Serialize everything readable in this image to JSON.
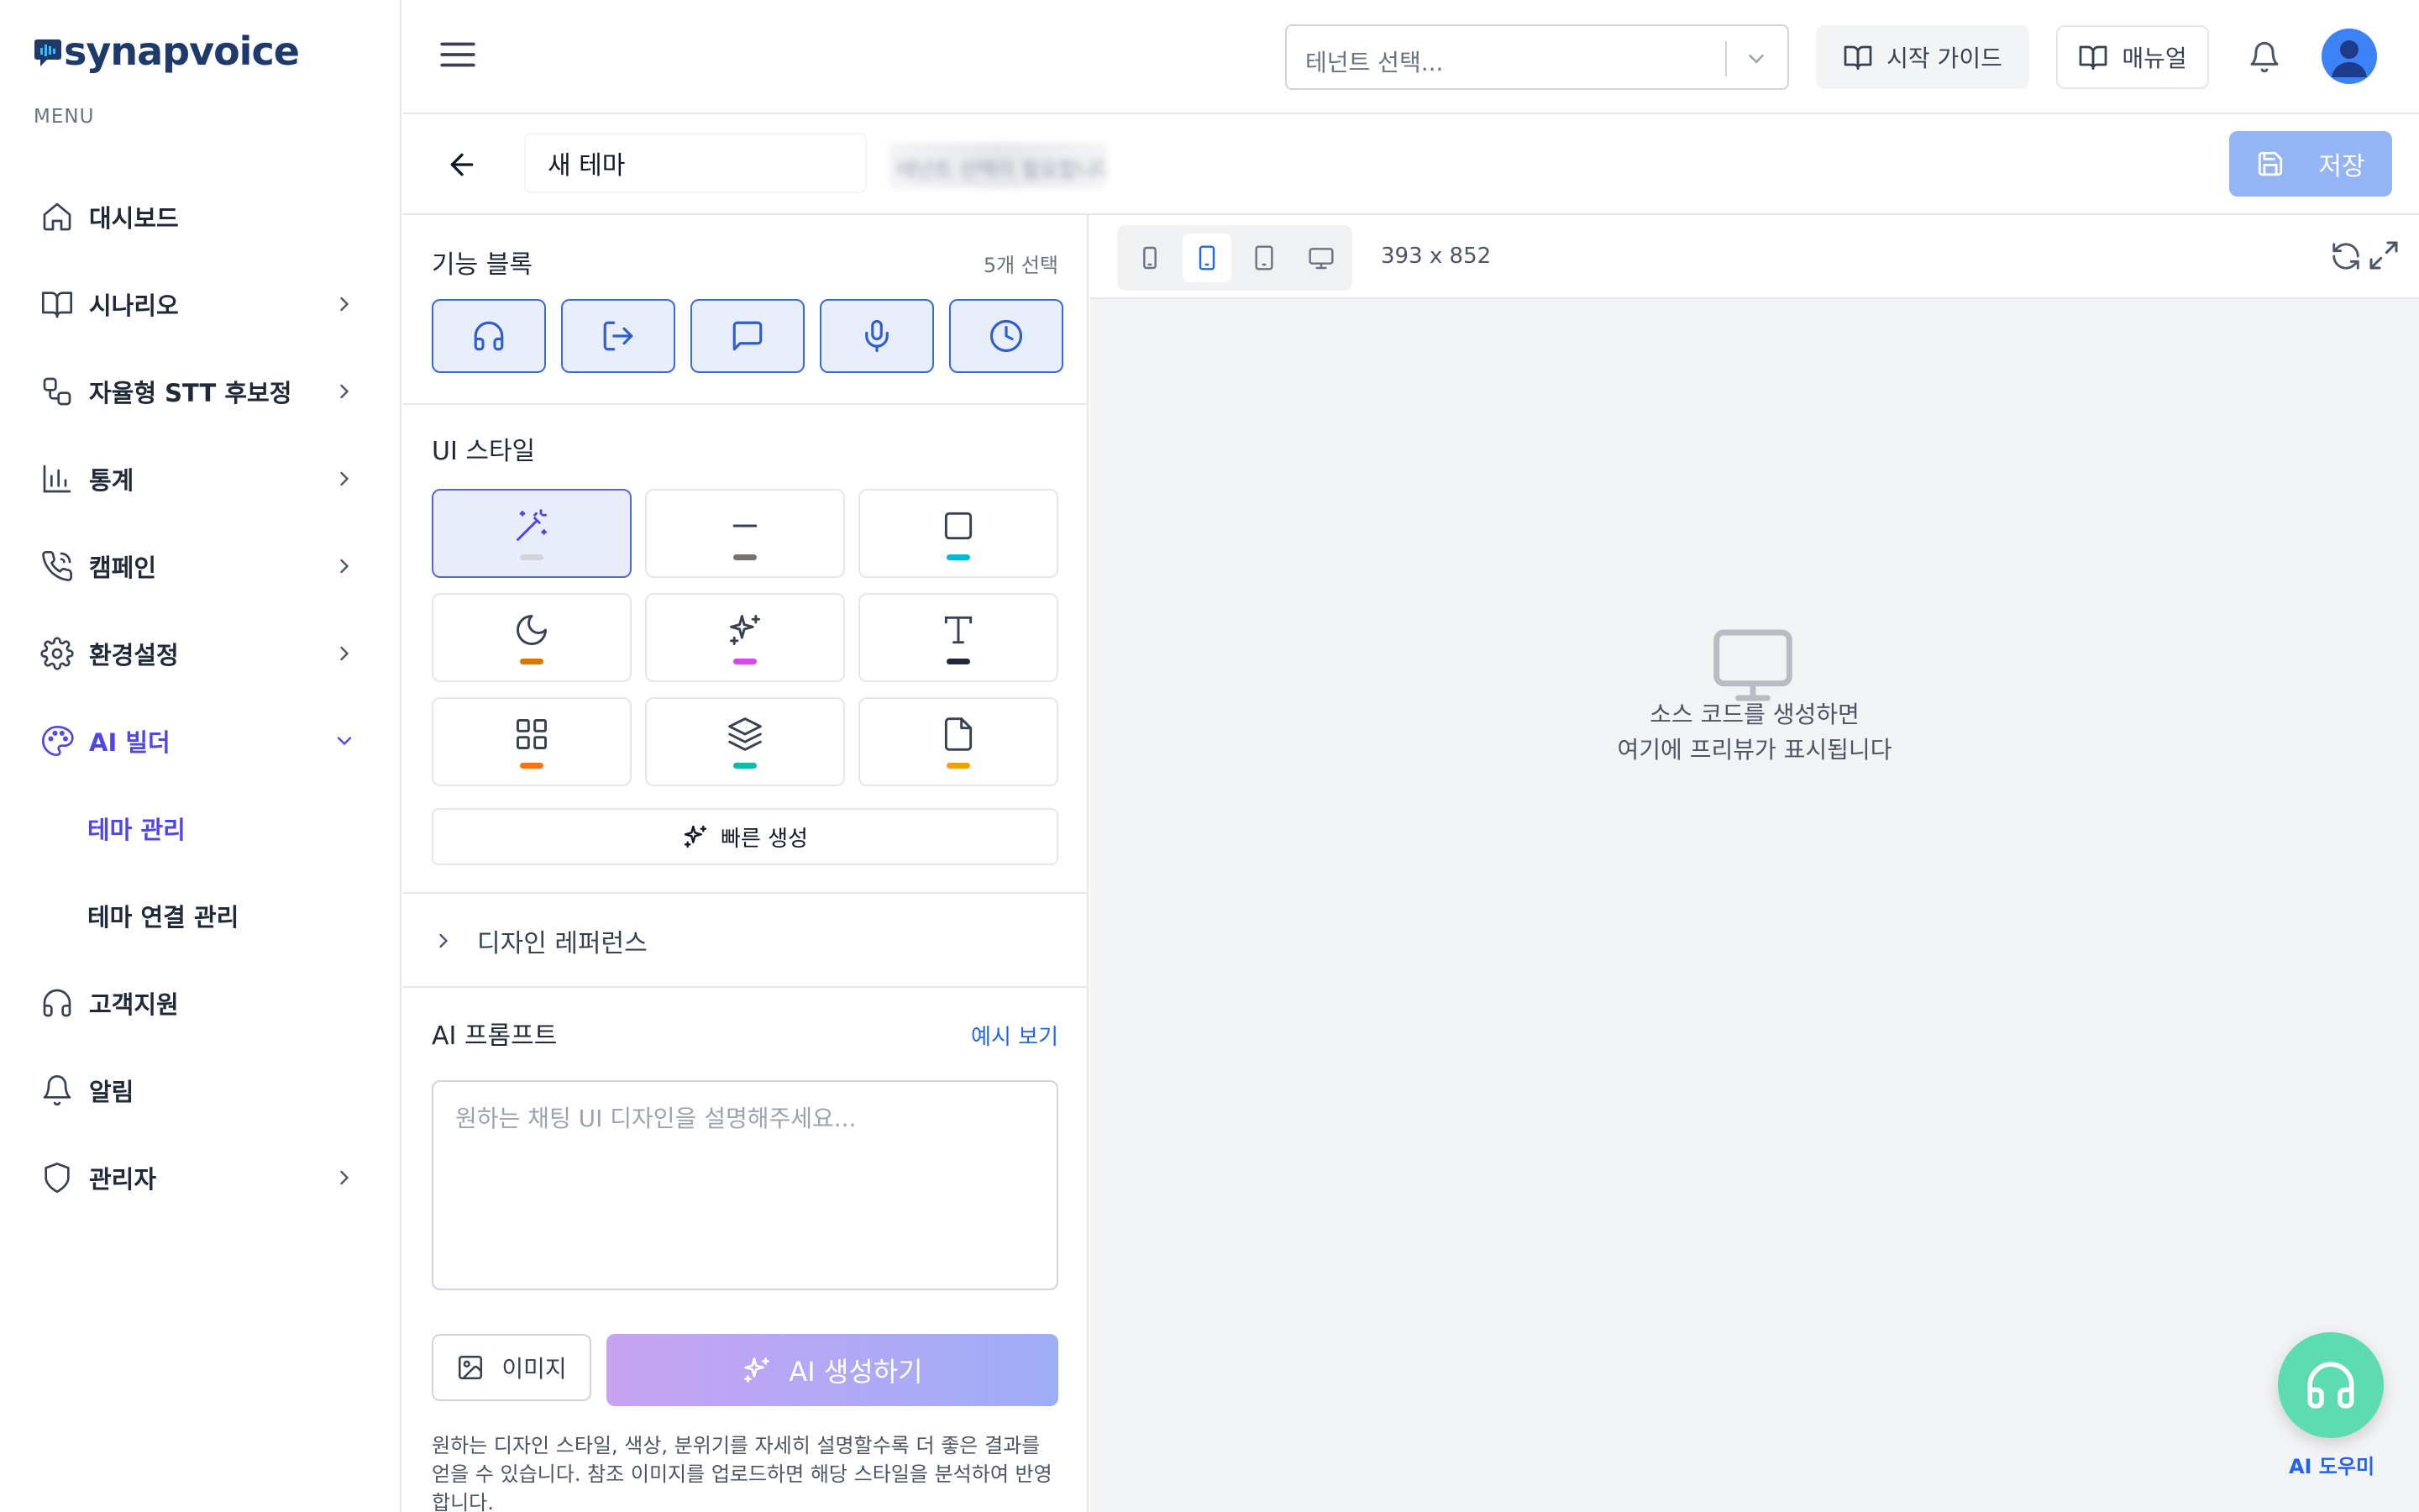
{
  "app": {
    "logo_text": "synapvoice",
    "menu_label": "MENU"
  },
  "sidebar": {
    "items": [
      {
        "label": "대시보드",
        "icon": "home-icon"
      },
      {
        "label": "시나리오",
        "icon": "book-icon",
        "has_chevron": true
      },
      {
        "label": "자율형 STT 후보정",
        "icon": "workflow-icon",
        "has_chevron": true
      },
      {
        "label": "통계",
        "icon": "bar-chart-icon",
        "has_chevron": true
      },
      {
        "label": "캠페인",
        "icon": "phone-icon",
        "has_chevron": true
      },
      {
        "label": "환경설정",
        "icon": "gear-icon",
        "has_chevron": true
      },
      {
        "label": "AI 빌더",
        "icon": "palette-icon",
        "has_chevron": true,
        "expanded": true,
        "active": true
      },
      {
        "label": "고객지원",
        "icon": "headset-icon"
      },
      {
        "label": "알림",
        "icon": "bell-icon"
      },
      {
        "label": "관리자",
        "icon": "shield-icon",
        "has_chevron": true
      }
    ],
    "sub_items": [
      {
        "label": "테마 관리",
        "active": true
      },
      {
        "label": "테마 연결 관리"
      }
    ]
  },
  "header": {
    "tenant_placeholder": "테넌트 선택...",
    "guide_label": "시작 가이드",
    "manual_label": "매뉴얼"
  },
  "editor": {
    "theme_name": "새 테마",
    "blurred_status": "테넌트 선택이 필요합니다",
    "save_label": "저장"
  },
  "feature_blocks": {
    "title": "기능 블록",
    "selected_count": "5개 선택",
    "items": [
      "headphones-icon",
      "log-out-icon",
      "chat-icon",
      "mic-icon",
      "clock-icon"
    ]
  },
  "ui_style": {
    "title": "UI 스타일",
    "options": [
      {
        "icon": "magic-wand-icon",
        "swatch": "#e5e7eb",
        "selected": true
      },
      {
        "icon": "minus-icon",
        "swatch": "#78716c"
      },
      {
        "icon": "square-icon",
        "swatch": "#06b6d4"
      },
      {
        "icon": "moon-icon",
        "swatch": "#d97706"
      },
      {
        "icon": "sparkles-icon",
        "swatch": "#d946ef"
      },
      {
        "icon": "type-icon",
        "swatch": "#1f2937"
      },
      {
        "icon": "grid-icon",
        "swatch": "#f97316"
      },
      {
        "icon": "layers-icon",
        "swatch": "#14b8a6"
      },
      {
        "icon": "file-icon",
        "swatch": "#f59e0b"
      }
    ],
    "quick_label": "빠른 생성"
  },
  "design_reference": {
    "label": "디자인 레퍼런스"
  },
  "ai_prompt": {
    "title": "AI 프롬프트",
    "example_link": "예시 보기",
    "placeholder": "원하는 채팅 UI 디자인을 설명해주세요...",
    "value": "",
    "image_label": "이미지",
    "generate_label": "AI 생성하기",
    "help_text": "원하는 디자인 스타일, 색상, 분위기를 자세히 설명할수록 더 좋은 결과를 얻을 수 있습니다. 참조 이미지를 업로드하면 해당 스타일을 분석하여 반영합니다."
  },
  "preview": {
    "dimensions": "393 x 852",
    "empty_line1": "소스 코드를 생성하면",
    "empty_line2": "여기에 프리뷰가 표시됩니다",
    "device_selected": "mobile-icon"
  },
  "assistant": {
    "label": "AI 도우미"
  },
  "colors": {
    "accent": "#4f46e5",
    "primary": "#2563eb",
    "save_disabled": "#93b4f5",
    "assistant": "#5ddbb1"
  }
}
